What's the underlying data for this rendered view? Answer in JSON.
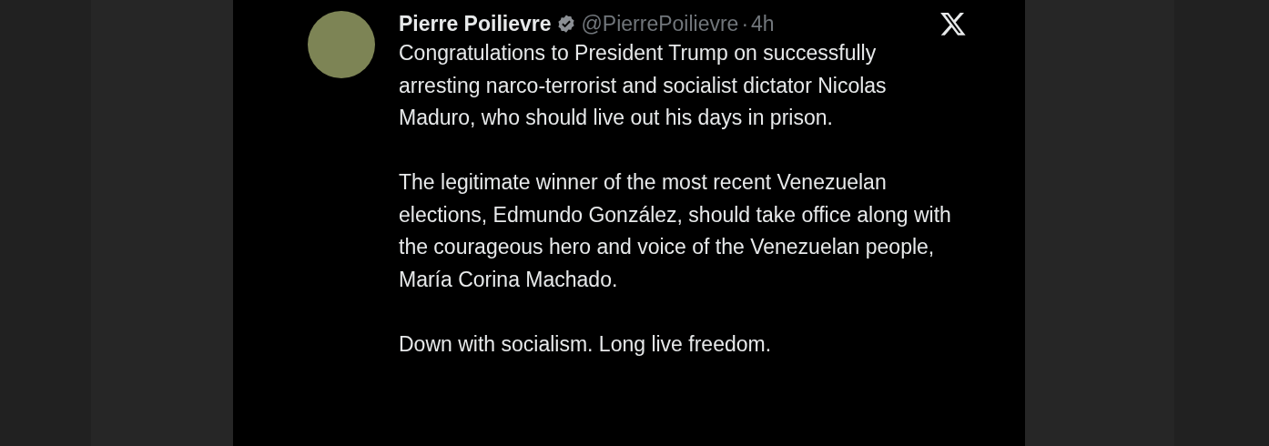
{
  "post": {
    "author_name": "Pierre Poilievre",
    "verified": true,
    "handle": "@PierrePoilievre",
    "separator": "·",
    "time": "4h",
    "paragraphs": [
      "Congratulations to President Trump on successfully arresting narco-terrorist and socialist dictator Nicolas Maduro, who should live out his days in prison.",
      "The legitimate winner of the most recent Venezuelan elections, Edmundo González, should take office along with the courageous hero and voice of the Venezuelan people, María Corina Machado.",
      "Down with socialism. Long live freedom."
    ]
  }
}
